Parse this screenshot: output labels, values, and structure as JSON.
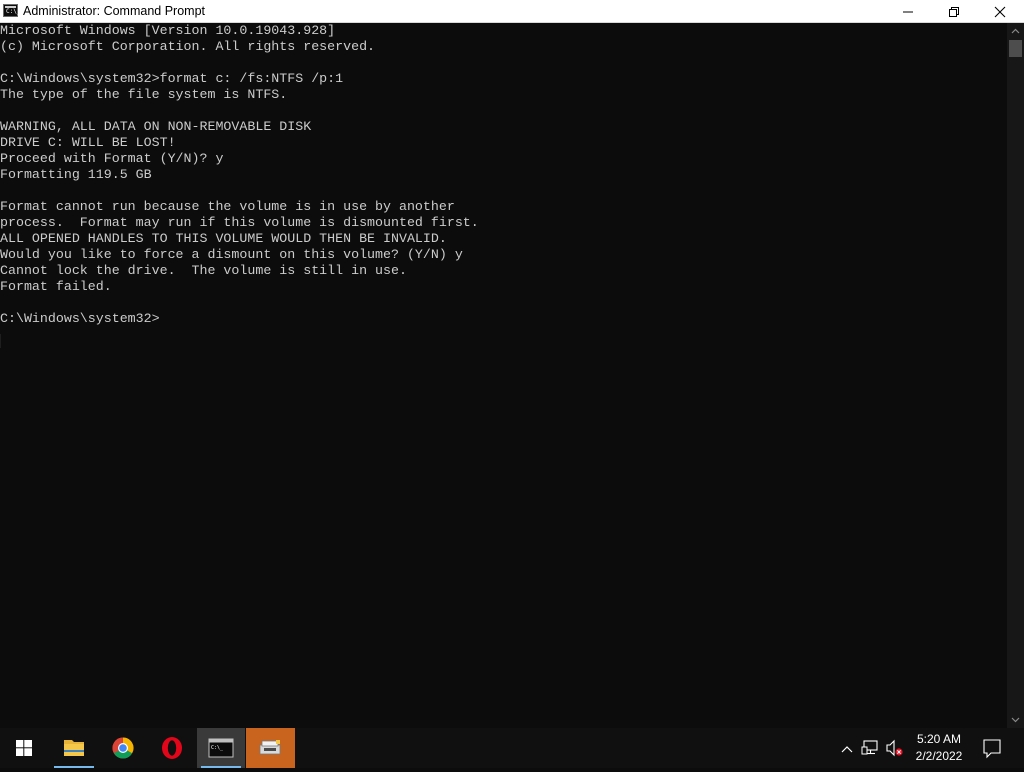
{
  "window": {
    "title": "Administrator: Command Prompt",
    "icon": "cmd-icon",
    "controls": {
      "minimize": "minimize-icon",
      "maximize": "restore-icon",
      "close": "close-icon"
    }
  },
  "console": {
    "lines": [
      "Microsoft Windows [Version 10.0.19043.928]",
      "(c) Microsoft Corporation. All rights reserved.",
      "",
      "C:\\Windows\\system32>format c: /fs:NTFS /p:1",
      "The type of the file system is NTFS.",
      "",
      "WARNING, ALL DATA ON NON-REMOVABLE DISK",
      "DRIVE C: WILL BE LOST!",
      "Proceed with Format (Y/N)? y",
      "Formatting 119.5 GB",
      "",
      "Format cannot run because the volume is in use by another",
      "process.  Format may run if this volume is dismounted first.",
      "ALL OPENED HANDLES TO THIS VOLUME WOULD THEN BE INVALID.",
      "Would you like to force a dismount on this volume? (Y/N) y",
      "Cannot lock the drive.  The volume is still in use.",
      "Format failed.",
      "",
      "C:\\Windows\\system32>"
    ]
  },
  "taskbar": {
    "apps": [
      {
        "name": "start",
        "icon": "windows-logo-icon"
      },
      {
        "name": "file-explorer",
        "icon": "folder-icon",
        "running": true
      },
      {
        "name": "chrome",
        "icon": "chrome-icon"
      },
      {
        "name": "opera",
        "icon": "opera-icon"
      },
      {
        "name": "command-prompt",
        "icon": "cmd-icon",
        "running": true,
        "active": true
      },
      {
        "name": "installer",
        "icon": "installer-icon",
        "highlighted": true
      }
    ],
    "tray": {
      "icons": [
        "chevron-up-icon",
        "network-icon",
        "volume-muted-icon"
      ],
      "time": "5:20 AM",
      "date": "2/2/2022",
      "notifications_icon": "action-center-icon"
    }
  },
  "colors": {
    "console_bg": "#0c0c0c",
    "console_text": "#cccccc",
    "taskbar_bg": "#101010",
    "active_underline": "#76b9ed",
    "installer_highlight": "#c8641e"
  }
}
